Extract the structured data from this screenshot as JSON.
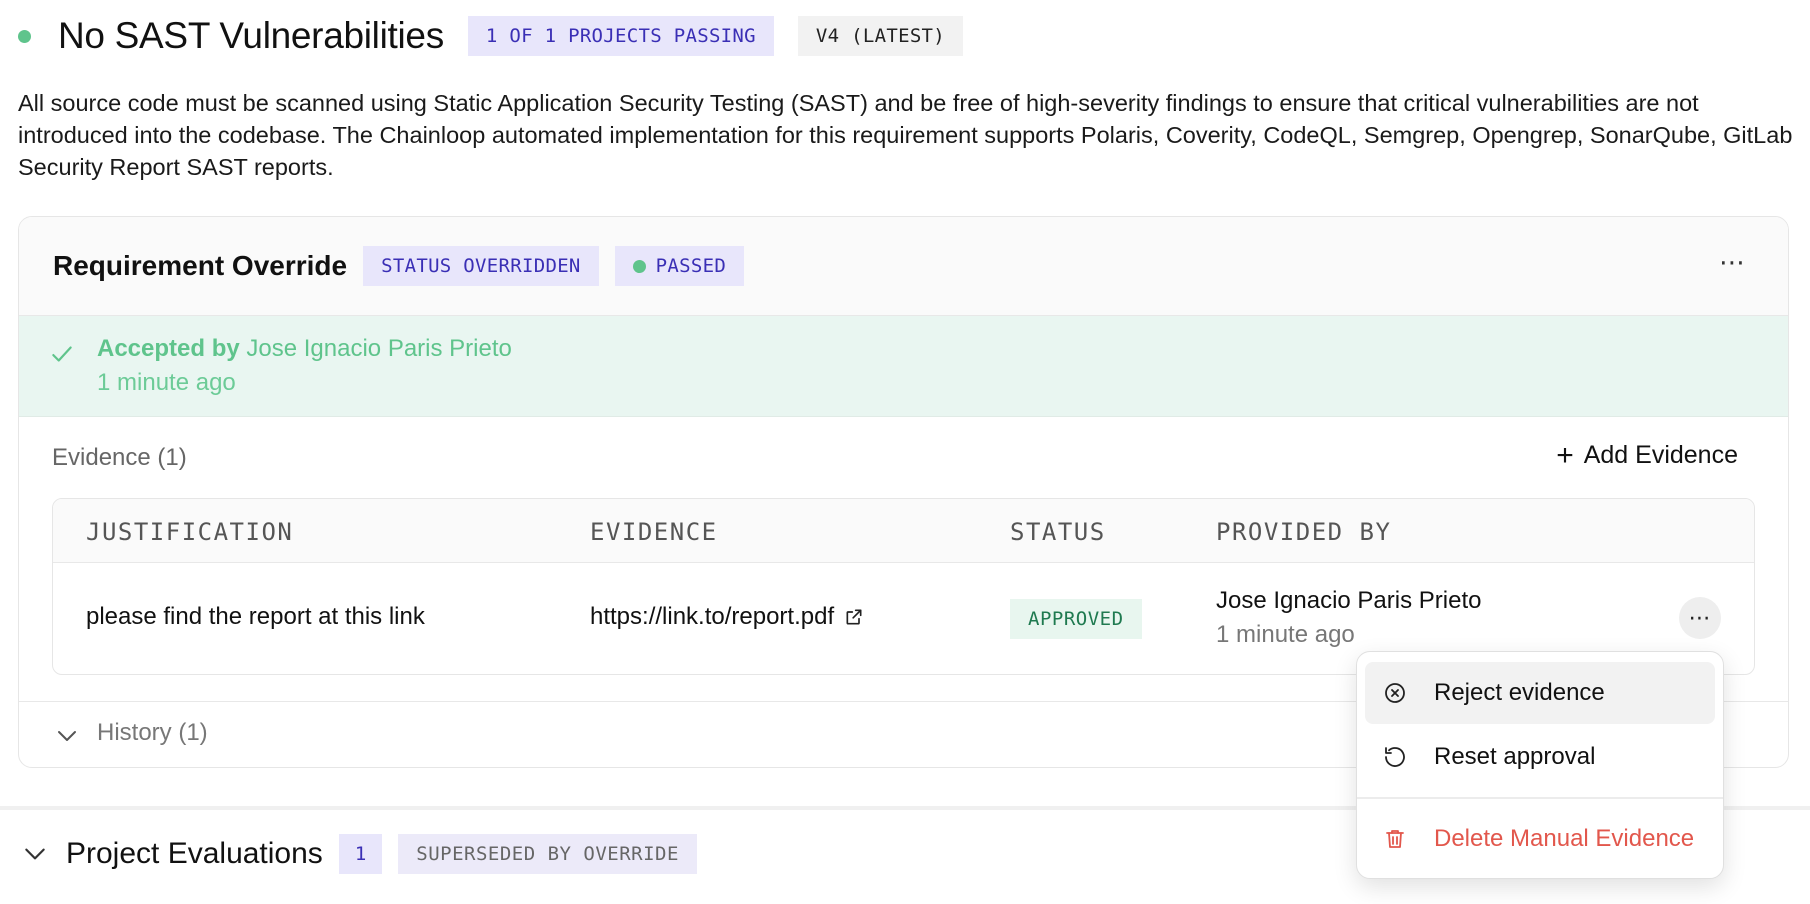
{
  "header": {
    "title": "No SAST Vulnerabilities",
    "projects_badge": "1 OF 1 PROJECTS PASSING",
    "version_badge": "V4 (LATEST)",
    "status_color": "#5fc48c"
  },
  "description": "All source code must be scanned using Static Application Security Testing (SAST) and be free of high-severity findings to ensure that critical vulnerabilities are not introduced into the codebase. The Chainloop automated implementation for this requirement supports Polaris, Coverity, CodeQL, Semgrep, Opengrep, SonarQube, GitLab Security Report SAST reports.",
  "override": {
    "title": "Requirement Override",
    "status_badge": "STATUS OVERRIDDEN",
    "result_badge": "PASSED",
    "menu_icon": "ellipsis-icon",
    "accepted": {
      "prefix": "Accepted by",
      "name": "Jose Ignacio Paris Prieto",
      "time": "1 minute ago",
      "icon": "check-icon"
    },
    "evidence": {
      "label": "Evidence (1)",
      "add_label": "Add Evidence",
      "columns": [
        "JUSTIFICATION",
        "EVIDENCE",
        "STATUS",
        "PROVIDED BY"
      ],
      "rows": [
        {
          "justification": "please find the report at this link",
          "evidence": "https://link.to/report.pdf",
          "status": "APPROVED",
          "provided_by": "Jose Ignacio Paris Prieto",
          "provided_time": "1 minute ago"
        }
      ]
    },
    "history_label": "History (1)"
  },
  "project_evaluations": {
    "title": "Project Evaluations",
    "count": "1",
    "badge": "SUPERSEDED BY OVERRIDE"
  },
  "row_menu": {
    "items": [
      {
        "label": "Reject evidence",
        "icon": "x-circle-icon"
      },
      {
        "label": "Reset approval",
        "icon": "rotate-ccw-icon"
      },
      {
        "label": "Delete Manual Evidence",
        "icon": "trash-icon",
        "color": "#e2574c"
      }
    ]
  }
}
